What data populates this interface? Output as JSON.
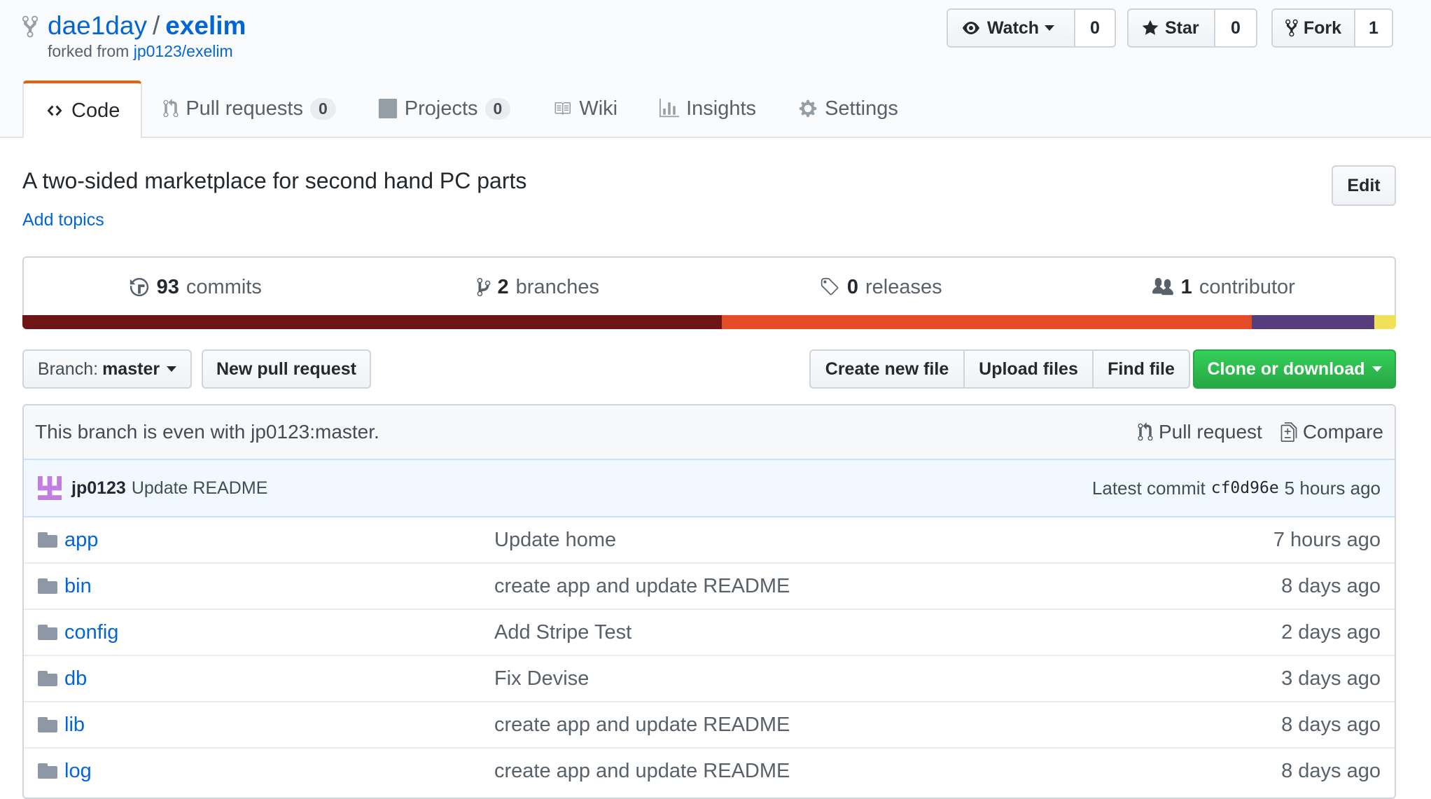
{
  "repo": {
    "owner": "dae1day",
    "separator": "/",
    "name": "exelim",
    "forked_prefix": "forked from",
    "forked_source": "jp0123/exelim"
  },
  "actions": {
    "watch_label": "Watch",
    "watch_count": "0",
    "star_label": "Star",
    "star_count": "0",
    "fork_label": "Fork",
    "fork_count": "1"
  },
  "tabs": [
    {
      "label": "Code",
      "icon": "code-icon",
      "selected": true
    },
    {
      "label": "Pull requests",
      "icon": "git-pull-request-icon",
      "count": "0"
    },
    {
      "label": "Projects",
      "icon": "project-icon",
      "count": "0"
    },
    {
      "label": "Wiki",
      "icon": "book-icon"
    },
    {
      "label": "Insights",
      "icon": "graph-icon"
    },
    {
      "label": "Settings",
      "icon": "gear-icon"
    }
  ],
  "about": {
    "description": "A two-sided marketplace for second hand PC parts",
    "add_topics": "Add topics",
    "edit_label": "Edit"
  },
  "summary": {
    "commits_num": "93",
    "commits_label": "commits",
    "branches_num": "2",
    "branches_label": "branches",
    "releases_num": "0",
    "releases_label": "releases",
    "contributors_num": "1",
    "contributors_label": "contributor"
  },
  "languages": [
    {
      "color": "#701516",
      "fraction": 0.509
    },
    {
      "color": "#e34c26",
      "fraction": 0.386
    },
    {
      "color": "#563d7c",
      "fraction": 0.089
    },
    {
      "color": "#f1e05a",
      "fraction": 0.016
    }
  ],
  "toolbar": {
    "branch_prefix": "Branch:",
    "branch_name": "master",
    "new_pr": "New pull request",
    "create_file": "Create new file",
    "upload_files": "Upload files",
    "find_file": "Find file",
    "clone": "Clone or download"
  },
  "branch_status": {
    "text": "This branch is even with jp0123:master.",
    "pull_request": "Pull request",
    "compare": "Compare"
  },
  "latest_commit": {
    "author": "jp0123",
    "message": "Update README",
    "prefix": "Latest commit",
    "sha": "cf0d96e",
    "age": "5 hours ago"
  },
  "files": [
    {
      "name": "app",
      "message": "Update home",
      "age": "7 hours ago"
    },
    {
      "name": "bin",
      "message": "create app and update README",
      "age": "8 days ago"
    },
    {
      "name": "config",
      "message": "Add Stripe Test",
      "age": "2 days ago"
    },
    {
      "name": "db",
      "message": "Fix Devise",
      "age": "3 days ago"
    },
    {
      "name": "lib",
      "message": "create app and update README",
      "age": "8 days ago"
    },
    {
      "name": "log",
      "message": "create app and update README",
      "age": "8 days ago"
    }
  ]
}
